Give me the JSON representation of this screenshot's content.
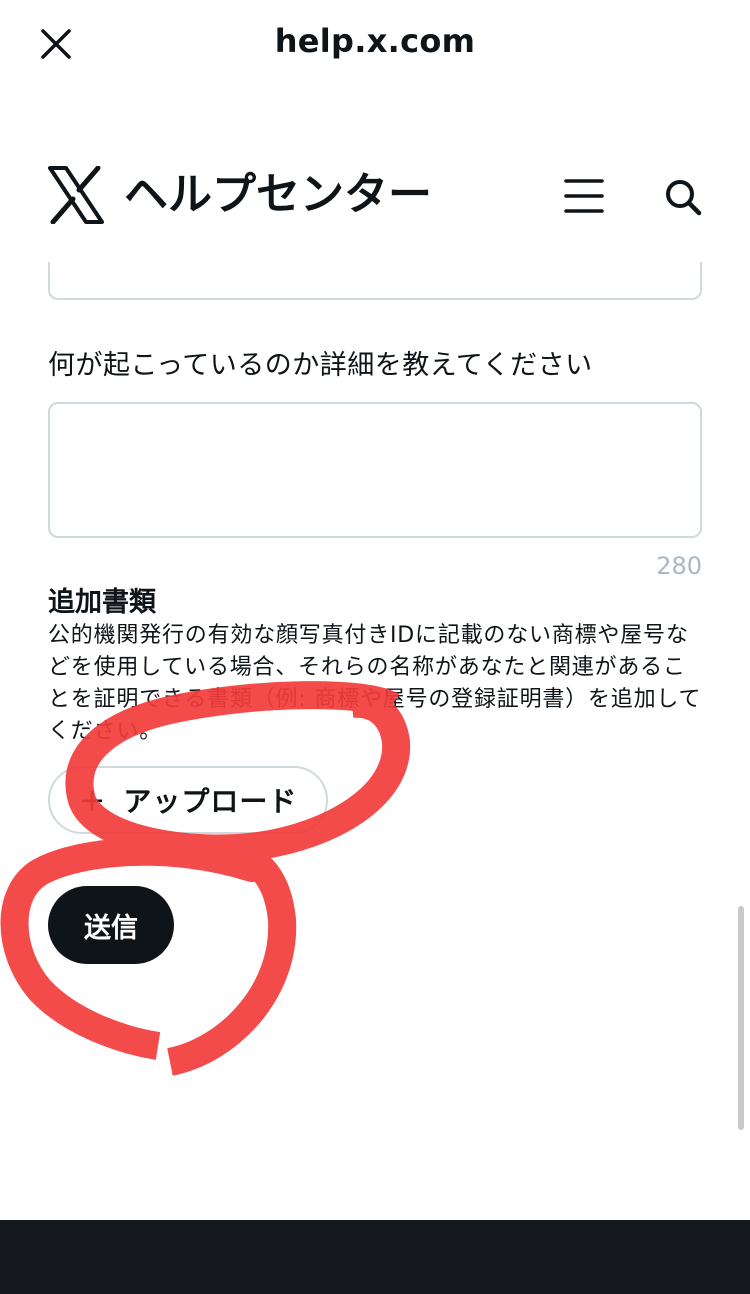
{
  "browser": {
    "url": "help.x.com",
    "close_icon": "close-icon"
  },
  "header": {
    "logo_icon": "x-logo-icon",
    "title": "ヘルプセンター",
    "menu_icon": "hamburger-menu-icon",
    "search_icon": "search-icon"
  },
  "form": {
    "details_label": "何が起こっているのか詳細を教えてください",
    "details_value": "",
    "char_count": "280",
    "attachments": {
      "title": "追加書類",
      "description": "公的機関発行の有効な顔写真付きIDに記載のない商標や屋号などを使用している場合、それらの名称があなたと関連があることを証明できる書類（例: 商標や屋号の登録証明書）を追加してください。",
      "upload_icon": "plus-icon",
      "upload_label": "アップロード"
    },
    "submit_label": "送信"
  },
  "colors": {
    "text": "#0f1419",
    "border": "#cfd9de",
    "muted": "#aab8c2",
    "button_dark": "#0f1419",
    "annotation": "#f23b3b"
  }
}
